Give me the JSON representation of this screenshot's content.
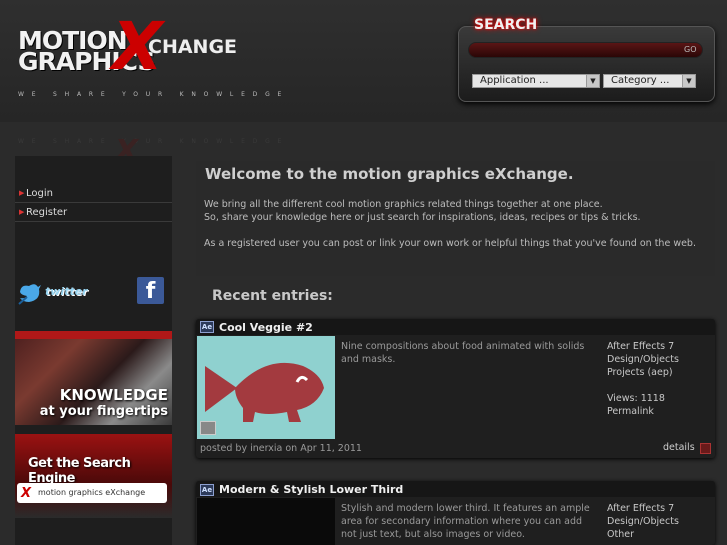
{
  "logo": {
    "line1": "MOTION",
    "line2": "GRAPHICS",
    "x": "X",
    "change": "CHANGE",
    "tagline": "WE SHARE YOUR KNOWLEDGE"
  },
  "search": {
    "title": "SEARCH",
    "placeholder": "",
    "go_label": "GO",
    "application_select": "Application ...",
    "category_select": "Category ..."
  },
  "nav": {
    "items": [
      {
        "label": "Login"
      },
      {
        "label": "Register"
      }
    ]
  },
  "social": {
    "twitter_label": "twitter",
    "facebook_label": "f"
  },
  "banners": {
    "knowledge_line1": "KNOWLEDGE",
    "knowledge_line2": "at your fingertips",
    "search_title": "Get the Search Engine",
    "search_field_text": "motion graphics eXchange"
  },
  "welcome": {
    "title": "Welcome to the motion graphics eXchange.",
    "para1_line1": "We bring all the different cool motion graphics related things together at one place.",
    "para1_line2": "So, share your knowledge here or just search for inspirations, ideas, recipes or tips & tricks.",
    "para2": "As a registered user you can post or link your own work or helpful things that you've found on the web."
  },
  "recent_title": "Recent entries:",
  "entries": [
    {
      "app_icon": "Ae",
      "title": "Cool Veggie #2",
      "description": "Nine compositions about food animated with solids and masks.",
      "meta": [
        "After Effects 7",
        "Design/Objects",
        "Projects (aep)"
      ],
      "views": "Views: 1118",
      "permalink": "Permalink",
      "posted": "posted by inerxia on Apr 11, 2011",
      "details": "details"
    },
    {
      "app_icon": "Ae",
      "title": "Modern & Stylish Lower Third",
      "description": "Stylish and modern lower third. It features an ample area for secondary information where you can add not just text, but also images or video.",
      "meta": [
        "After Effects 7",
        "Design/Objects",
        "Other"
      ]
    }
  ],
  "colors": {
    "accent_red": "#cc0000",
    "background": "#2b2b2b",
    "thumb_teal": "#8fd1cf",
    "fish_red": "#a33a3f"
  }
}
